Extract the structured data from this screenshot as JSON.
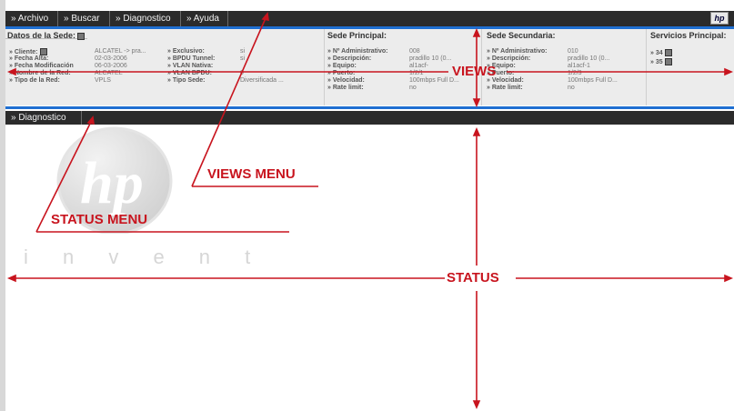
{
  "menubar": {
    "items": [
      "Archivo",
      "Buscar",
      "Diagnostico",
      "Ayuda"
    ],
    "logo_icon": "hp-logo-icon"
  },
  "views": {
    "site_data": {
      "title": "Datos de la Sede:",
      "rows_left": [
        {
          "label": "» Cliente:",
          "value": "ALCATEL -> pra..."
        },
        {
          "label": "» Fecha Alta:",
          "value": "02-03-2006"
        },
        {
          "label": "» Fecha Modificación",
          "value": "06-03-2006"
        },
        {
          "label": "» Nombre de la Red:",
          "value": "ALCATEL"
        },
        {
          "label": "» Tipo de la Red:",
          "value": "VPLS"
        }
      ],
      "rows_right": [
        {
          "label": "» Exclusivo:",
          "value": "si"
        },
        {
          "label": "» BPDU Tunnel:",
          "value": "si"
        },
        {
          "label": "» VLAN Nativa:",
          "value": ""
        },
        {
          "label": "» VLAN BPDU:",
          "value": "0"
        },
        {
          "label": "» Tipo Sede:",
          "value": "Diversificada ..."
        }
      ]
    },
    "main_site": {
      "title": "Sede Principal:",
      "rows": [
        {
          "label": "» Nº Administrativo:",
          "value": "008"
        },
        {
          "label": "» Descripción:",
          "value": "pradillo 10 (0..."
        },
        {
          "label": "» Equipo:",
          "value": "al1acf-"
        },
        {
          "label": "» Puerto:",
          "value": "1/2/1"
        },
        {
          "label": "» Velocidad:",
          "value": "100mbps Full D..."
        },
        {
          "label": "» Rate limit:",
          "value": "no"
        }
      ]
    },
    "secondary_site": {
      "title": "Sede Secundaria:",
      "rows": [
        {
          "label": "» Nº Administrativo:",
          "value": "010"
        },
        {
          "label": "» Descripción:",
          "value": "pradillo 10 (0..."
        },
        {
          "label": "» Equipo:",
          "value": "al1acf-1"
        },
        {
          "label": "» Puerto:",
          "value": "1/2/3"
        },
        {
          "label": "» Velocidad:",
          "value": "100mbps Full D..."
        },
        {
          "label": "» Rate limit:",
          "value": "no"
        }
      ]
    },
    "main_services": {
      "title": "Servicios Principal:",
      "items": [
        "» 34",
        "» 35"
      ]
    }
  },
  "statusbar": {
    "tab": "Diagnostico"
  },
  "status": {
    "logo_text": "hp",
    "tagline": "i n v e n t"
  },
  "annotations": {
    "views": "VIEWS",
    "views_menu": "VIEWS MENU",
    "status_menu": "STATUS MENU",
    "status": "STATUS"
  },
  "colors": {
    "accent": "#c8141e",
    "bar": "#2b2b2b",
    "blue": "#1f6fd1"
  }
}
